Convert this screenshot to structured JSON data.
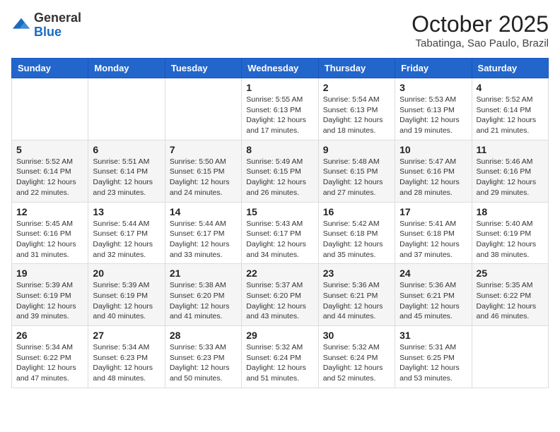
{
  "header": {
    "logo_general": "General",
    "logo_blue": "Blue",
    "month": "October 2025",
    "location": "Tabatinga, Sao Paulo, Brazil"
  },
  "weekdays": [
    "Sunday",
    "Monday",
    "Tuesday",
    "Wednesday",
    "Thursday",
    "Friday",
    "Saturday"
  ],
  "weeks": [
    [
      {
        "day": "",
        "info": ""
      },
      {
        "day": "",
        "info": ""
      },
      {
        "day": "",
        "info": ""
      },
      {
        "day": "1",
        "info": "Sunrise: 5:55 AM\nSunset: 6:13 PM\nDaylight: 12 hours\nand 17 minutes."
      },
      {
        "day": "2",
        "info": "Sunrise: 5:54 AM\nSunset: 6:13 PM\nDaylight: 12 hours\nand 18 minutes."
      },
      {
        "day": "3",
        "info": "Sunrise: 5:53 AM\nSunset: 6:13 PM\nDaylight: 12 hours\nand 19 minutes."
      },
      {
        "day": "4",
        "info": "Sunrise: 5:52 AM\nSunset: 6:14 PM\nDaylight: 12 hours\nand 21 minutes."
      }
    ],
    [
      {
        "day": "5",
        "info": "Sunrise: 5:52 AM\nSunset: 6:14 PM\nDaylight: 12 hours\nand 22 minutes."
      },
      {
        "day": "6",
        "info": "Sunrise: 5:51 AM\nSunset: 6:14 PM\nDaylight: 12 hours\nand 23 minutes."
      },
      {
        "day": "7",
        "info": "Sunrise: 5:50 AM\nSunset: 6:15 PM\nDaylight: 12 hours\nand 24 minutes."
      },
      {
        "day": "8",
        "info": "Sunrise: 5:49 AM\nSunset: 6:15 PM\nDaylight: 12 hours\nand 26 minutes."
      },
      {
        "day": "9",
        "info": "Sunrise: 5:48 AM\nSunset: 6:15 PM\nDaylight: 12 hours\nand 27 minutes."
      },
      {
        "day": "10",
        "info": "Sunrise: 5:47 AM\nSunset: 6:16 PM\nDaylight: 12 hours\nand 28 minutes."
      },
      {
        "day": "11",
        "info": "Sunrise: 5:46 AM\nSunset: 6:16 PM\nDaylight: 12 hours\nand 29 minutes."
      }
    ],
    [
      {
        "day": "12",
        "info": "Sunrise: 5:45 AM\nSunset: 6:16 PM\nDaylight: 12 hours\nand 31 minutes."
      },
      {
        "day": "13",
        "info": "Sunrise: 5:44 AM\nSunset: 6:17 PM\nDaylight: 12 hours\nand 32 minutes."
      },
      {
        "day": "14",
        "info": "Sunrise: 5:44 AM\nSunset: 6:17 PM\nDaylight: 12 hours\nand 33 minutes."
      },
      {
        "day": "15",
        "info": "Sunrise: 5:43 AM\nSunset: 6:17 PM\nDaylight: 12 hours\nand 34 minutes."
      },
      {
        "day": "16",
        "info": "Sunrise: 5:42 AM\nSunset: 6:18 PM\nDaylight: 12 hours\nand 35 minutes."
      },
      {
        "day": "17",
        "info": "Sunrise: 5:41 AM\nSunset: 6:18 PM\nDaylight: 12 hours\nand 37 minutes."
      },
      {
        "day": "18",
        "info": "Sunrise: 5:40 AM\nSunset: 6:19 PM\nDaylight: 12 hours\nand 38 minutes."
      }
    ],
    [
      {
        "day": "19",
        "info": "Sunrise: 5:39 AM\nSunset: 6:19 PM\nDaylight: 12 hours\nand 39 minutes."
      },
      {
        "day": "20",
        "info": "Sunrise: 5:39 AM\nSunset: 6:19 PM\nDaylight: 12 hours\nand 40 minutes."
      },
      {
        "day": "21",
        "info": "Sunrise: 5:38 AM\nSunset: 6:20 PM\nDaylight: 12 hours\nand 41 minutes."
      },
      {
        "day": "22",
        "info": "Sunrise: 5:37 AM\nSunset: 6:20 PM\nDaylight: 12 hours\nand 43 minutes."
      },
      {
        "day": "23",
        "info": "Sunrise: 5:36 AM\nSunset: 6:21 PM\nDaylight: 12 hours\nand 44 minutes."
      },
      {
        "day": "24",
        "info": "Sunrise: 5:36 AM\nSunset: 6:21 PM\nDaylight: 12 hours\nand 45 minutes."
      },
      {
        "day": "25",
        "info": "Sunrise: 5:35 AM\nSunset: 6:22 PM\nDaylight: 12 hours\nand 46 minutes."
      }
    ],
    [
      {
        "day": "26",
        "info": "Sunrise: 5:34 AM\nSunset: 6:22 PM\nDaylight: 12 hours\nand 47 minutes."
      },
      {
        "day": "27",
        "info": "Sunrise: 5:34 AM\nSunset: 6:23 PM\nDaylight: 12 hours\nand 48 minutes."
      },
      {
        "day": "28",
        "info": "Sunrise: 5:33 AM\nSunset: 6:23 PM\nDaylight: 12 hours\nand 50 minutes."
      },
      {
        "day": "29",
        "info": "Sunrise: 5:32 AM\nSunset: 6:24 PM\nDaylight: 12 hours\nand 51 minutes."
      },
      {
        "day": "30",
        "info": "Sunrise: 5:32 AM\nSunset: 6:24 PM\nDaylight: 12 hours\nand 52 minutes."
      },
      {
        "day": "31",
        "info": "Sunrise: 5:31 AM\nSunset: 6:25 PM\nDaylight: 12 hours\nand 53 minutes."
      },
      {
        "day": "",
        "info": ""
      }
    ]
  ]
}
